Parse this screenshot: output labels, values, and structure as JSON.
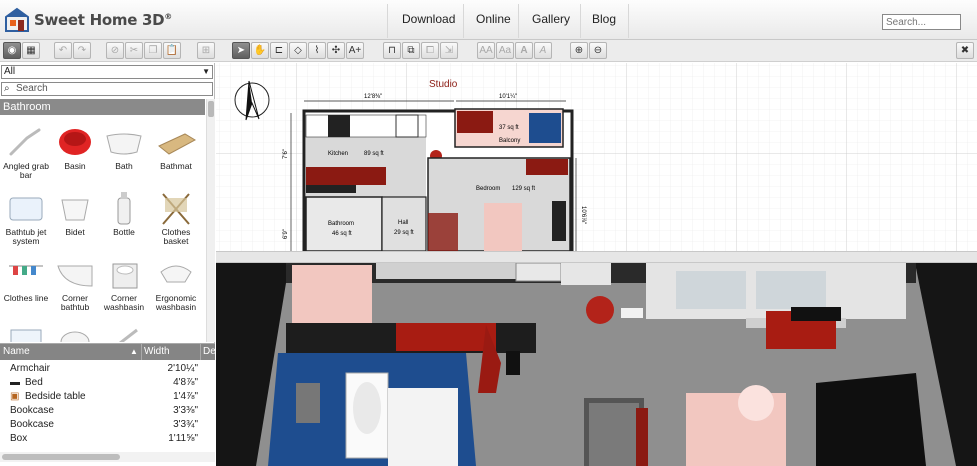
{
  "app": {
    "name": "Sweet Home 3D",
    "reg": "®"
  },
  "nav": {
    "download": "Download",
    "online": "Online",
    "gallery": "Gallery",
    "blog": "Blog"
  },
  "search": {
    "placeholder": "Search..."
  },
  "catalog": {
    "filter_value": "All",
    "search_placeholder": "Search",
    "category": "Bathroom",
    "items": [
      {
        "label": "Angled grab bar"
      },
      {
        "label": "Basin"
      },
      {
        "label": "Bath"
      },
      {
        "label": "Bathmat"
      },
      {
        "label": "Bathtub jet system"
      },
      {
        "label": "Bidet"
      },
      {
        "label": "Bottle"
      },
      {
        "label": "Clothes basket"
      },
      {
        "label": "Clothes line"
      },
      {
        "label": "Corner bathtub"
      },
      {
        "label": "Corner washbasin"
      },
      {
        "label": "Ergonomic washbasin"
      }
    ]
  },
  "furniture_table": {
    "columns": {
      "name": "Name",
      "width": "Width",
      "depth": "De"
    },
    "rows": [
      {
        "name": "Armchair",
        "width": "2'10¼\""
      },
      {
        "name": "Bed",
        "width": "4'8⅞\""
      },
      {
        "name": "Bedside table",
        "width": "1'4⅞\""
      },
      {
        "name": "Bookcase",
        "width": "3'3⅜\""
      },
      {
        "name": "Bookcase",
        "width": "3'3¾\""
      },
      {
        "name": "Box",
        "width": "1'11⅝\""
      }
    ]
  },
  "plan": {
    "title": "Studio",
    "dim_top_left": "12'8⅜\"",
    "dim_top_right": "10'1¼\"",
    "dim_right": "10'6⅞\"",
    "dim_left_top": "7'6\"",
    "dim_left_bottom": "6'9\"",
    "rooms": [
      {
        "name": "Kitchen",
        "area": "89 sq ft"
      },
      {
        "name": "Balcony",
        "area": "37 sq ft"
      },
      {
        "name": "Bedroom",
        "area": "129 sq ft"
      },
      {
        "name": "Bathroom",
        "area": "46 sq ft"
      },
      {
        "name": "Hall",
        "area": "29 sq ft"
      }
    ]
  },
  "colors": {
    "wall_red": "#8b1a12",
    "accent_red": "#b3231a",
    "pink_floor": "#f2c7c0",
    "balcony_blue": "#1e4d8f"
  }
}
